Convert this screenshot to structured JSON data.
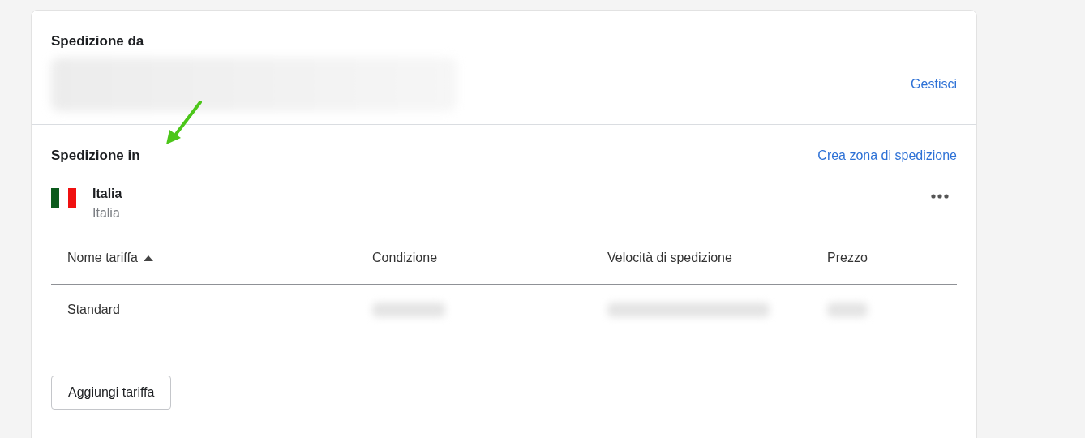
{
  "origin": {
    "title": "Spedizione da",
    "manage_link": "Gestisci"
  },
  "destinations": {
    "title": "Spedizione in",
    "create_link": "Crea zona di spedizione",
    "zone": {
      "name": "Italia",
      "countries": "Italia"
    },
    "table": {
      "columns": [
        {
          "label": "Nome tariffa",
          "sorted": true
        },
        {
          "label": "Condizione",
          "sorted": false
        },
        {
          "label": "Velocità di spedizione",
          "sorted": false
        },
        {
          "label": "Prezzo",
          "sorted": false
        }
      ],
      "rows": [
        {
          "name": "Standard"
        }
      ]
    },
    "add_button": "Aggiungi tariffa"
  }
}
